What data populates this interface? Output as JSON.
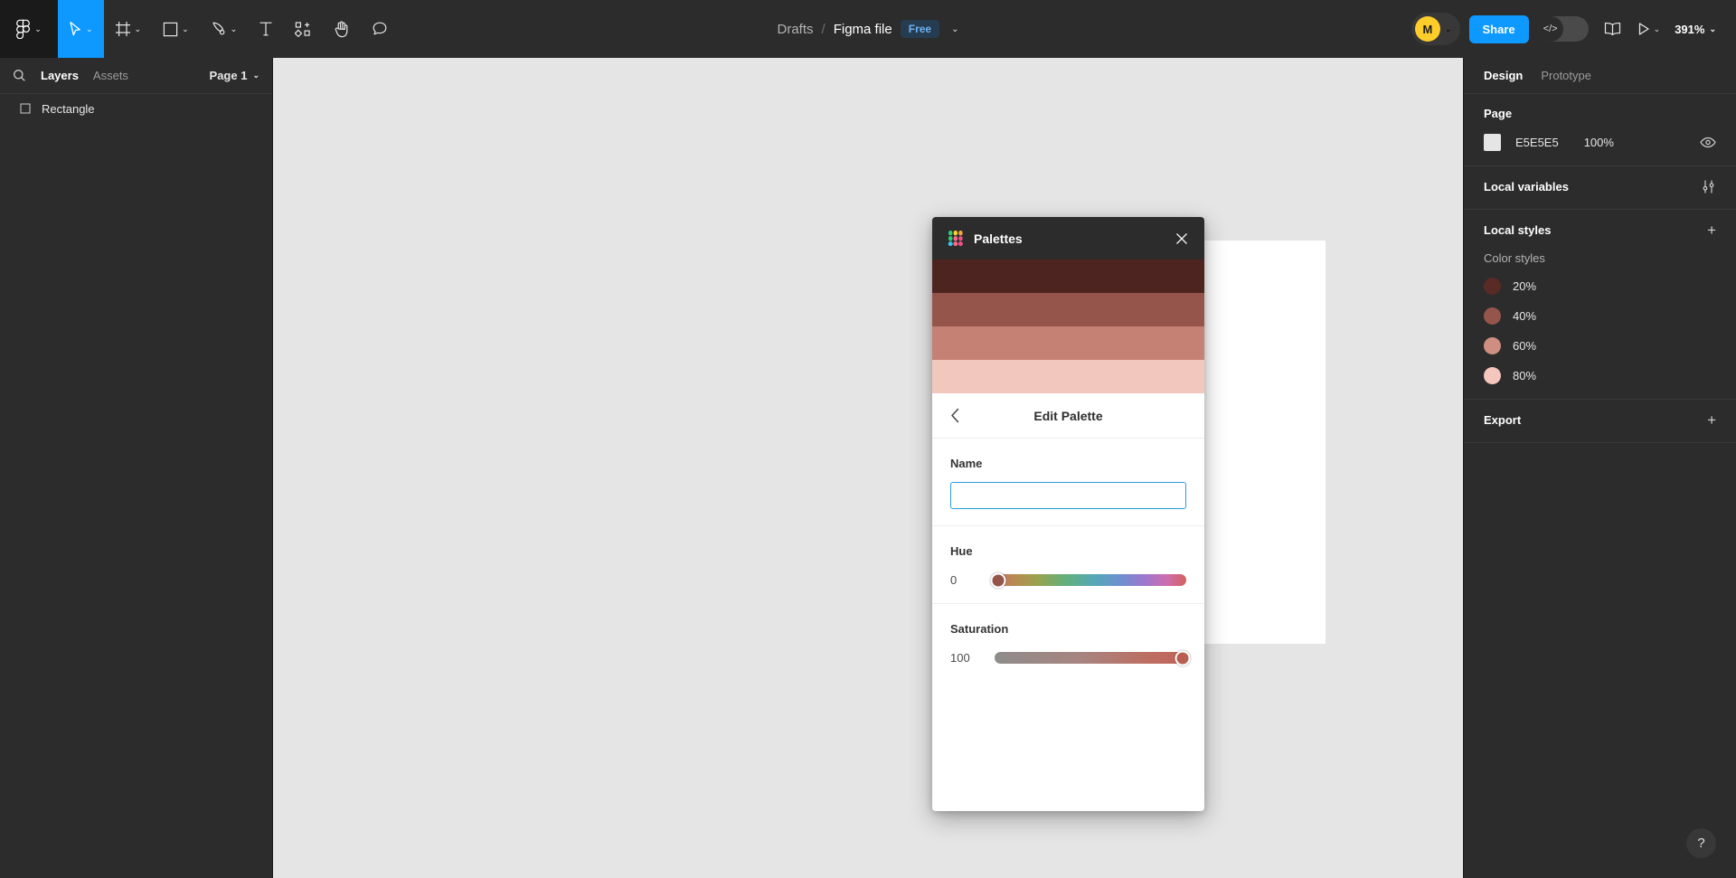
{
  "toolbar": {
    "tools": [
      {
        "name": "figma-logo",
        "icon": "figma-logo-icon",
        "caret": "⌄"
      },
      {
        "name": "move",
        "icon": "cursor-icon",
        "caret": "⌄"
      },
      {
        "name": "frame",
        "icon": "frame-icon",
        "caret": "⌄"
      },
      {
        "name": "shape",
        "icon": "square-icon",
        "caret": "⌄"
      },
      {
        "name": "pen",
        "icon": "pen-icon",
        "caret": "⌄"
      },
      {
        "name": "text",
        "icon": "text-icon",
        "caret": ""
      },
      {
        "name": "components",
        "icon": "components-icon",
        "caret": ""
      },
      {
        "name": "hand",
        "icon": "hand-icon",
        "caret": ""
      },
      {
        "name": "comment",
        "icon": "comment-icon",
        "caret": ""
      }
    ],
    "breadcrumb": {
      "project": "Drafts",
      "separator": "/",
      "file": "Figma file",
      "badge": "Free",
      "caret": "⌄"
    },
    "avatar": {
      "initial": "M",
      "caret": "⌄"
    },
    "share_label": "Share",
    "code_toggle": "</>",
    "zoom": "391%",
    "zoom_caret": "⌄",
    "play_caret": "⌄",
    "accent_color": "#0D99FF",
    "avatar_color": "#FFCD29",
    "badge_bg": "#263C50",
    "badge_fg": "#6FB3F2"
  },
  "left_panel": {
    "search_icon": "search-icon",
    "tabs": [
      {
        "label": "Layers",
        "active": true
      },
      {
        "label": "Assets",
        "active": false
      }
    ],
    "page": {
      "label": "Page 1",
      "caret": "⌄"
    },
    "layers": [
      {
        "name": "Rectangle",
        "icon": "rectangle-icon"
      }
    ]
  },
  "canvas": {
    "background": "#E5E5E5",
    "artboard_fill": "#FFFFFF"
  },
  "modal": {
    "title": "Palettes",
    "close_icon": "close-icon",
    "swatches": [
      "#4E2420",
      "#95554B",
      "#C58274",
      "#F2C8BE"
    ],
    "back_icon": "chevron-left-icon",
    "edit_title": "Edit Palette",
    "name": {
      "label": "Name",
      "value": "",
      "placeholder": ""
    },
    "hue": {
      "label": "Hue",
      "value": "0",
      "position_pct": 2
    },
    "saturation": {
      "label": "Saturation",
      "value": "100",
      "position_pct": 98
    }
  },
  "right_panel": {
    "tabs": [
      {
        "label": "Design",
        "active": true
      },
      {
        "label": "Prototype",
        "active": false
      }
    ],
    "page_section": {
      "title": "Page",
      "color_hex": "E5E5E5",
      "color_value": "#E5E5E5",
      "opacity": "100%",
      "eye_icon": "eye-icon"
    },
    "local_variables": {
      "title": "Local variables",
      "icon": "sliders-icon"
    },
    "local_styles": {
      "title": "Local styles",
      "plus": "+",
      "subhead": "Color styles",
      "styles": [
        {
          "label": "20%",
          "color": "#5A2A24"
        },
        {
          "label": "40%",
          "color": "#95554B"
        },
        {
          "label": "60%",
          "color": "#D08E80"
        },
        {
          "label": "80%",
          "color": "#F5C6BD"
        }
      ]
    },
    "export": {
      "title": "Export",
      "plus": "+"
    },
    "help": "?"
  }
}
